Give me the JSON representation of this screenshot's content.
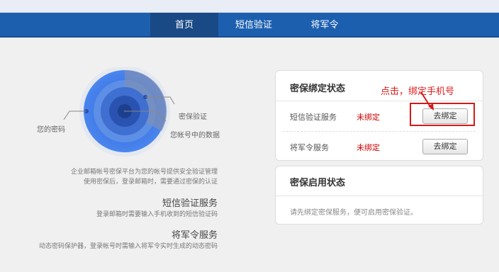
{
  "nav": {
    "tabs": [
      {
        "label": "首页",
        "active": true
      },
      {
        "label": "短信验证",
        "active": false
      },
      {
        "label": "将军令",
        "active": false
      }
    ]
  },
  "hero": {
    "label_password": "您的密码",
    "label_security": "密保验证",
    "label_data": "您帐号中的数据"
  },
  "intro": {
    "line1": "企业邮箱帐号密保平台为您的帐号提供安全验证管理",
    "line2": "使用密保后，登录邮箱时，需要通过密保的认证"
  },
  "features": [
    {
      "title": "短信验证服务",
      "desc": "登录邮箱时需要输入手机收到的短信验证码"
    },
    {
      "title": "将军令服务",
      "desc": "动态密码保护器，登录帐号时需输入将军令实时生成的动态密码"
    }
  ],
  "binding_card": {
    "title": "密保绑定状态",
    "rows": [
      {
        "service": "短信验证服务",
        "status": "未绑定",
        "button": "去绑定"
      },
      {
        "service": "将军令服务",
        "status": "未绑定",
        "button": "去绑定"
      }
    ]
  },
  "enable_card": {
    "title": "密保启用状态",
    "hint": "请先绑定密保服务，便可启用密保验证。"
  },
  "annotation": {
    "text": "点击，绑定手机号",
    "color": "#e01a1a"
  },
  "colors": {
    "nav_bg": "#1c5faf",
    "nav_active": "#1a4a86",
    "status_red": "#cc0000"
  }
}
